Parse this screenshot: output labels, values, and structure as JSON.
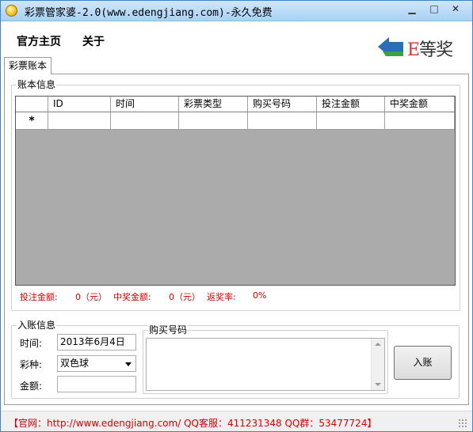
{
  "window": {
    "title": "彩票管家婆-2.0(www.edengjiang.com)-永久免费",
    "min_glyph": "▁",
    "max_glyph": "□",
    "close_glyph": "✕"
  },
  "menu": {
    "home": "官方主页",
    "about": "关于"
  },
  "logo": {
    "prefix": "E",
    "text": "等奖"
  },
  "tabs": [
    {
      "label": "彩票账本"
    }
  ],
  "account": {
    "group_title": "账本信息",
    "columns": [
      "ID",
      "时间",
      "彩票类型",
      "购买号码",
      "投注金额",
      "中奖金额"
    ],
    "new_row_marker": "*",
    "rows": []
  },
  "summary": {
    "bet_label": "投注金额:",
    "bet_value": "0（元）",
    "win_label": "中奖金额:",
    "win_value": "0（元）",
    "ratio_label": "返奖率:",
    "ratio_value": "0%"
  },
  "entry": {
    "group_title": "入账信息",
    "time_label": "时间:",
    "time_value": "2013年6月4日",
    "type_label": "彩种:",
    "type_value": "双色球",
    "amount_label": "金额:",
    "amount_value": "",
    "numbers_group_title": "购买号码",
    "numbers_value": "",
    "submit_label": "入账"
  },
  "status": {
    "text": "【官网：http://www.edengjiang.com/  QQ客服：411231348 QQ群：53477724】"
  },
  "colors": {
    "title_bar": "#a9d1f4",
    "grid_background": "#ababab",
    "summary_text": "#d40000",
    "status_text": "#d40000",
    "logo_green": "#3aa04a",
    "logo_blue": "#2a6fb5"
  }
}
